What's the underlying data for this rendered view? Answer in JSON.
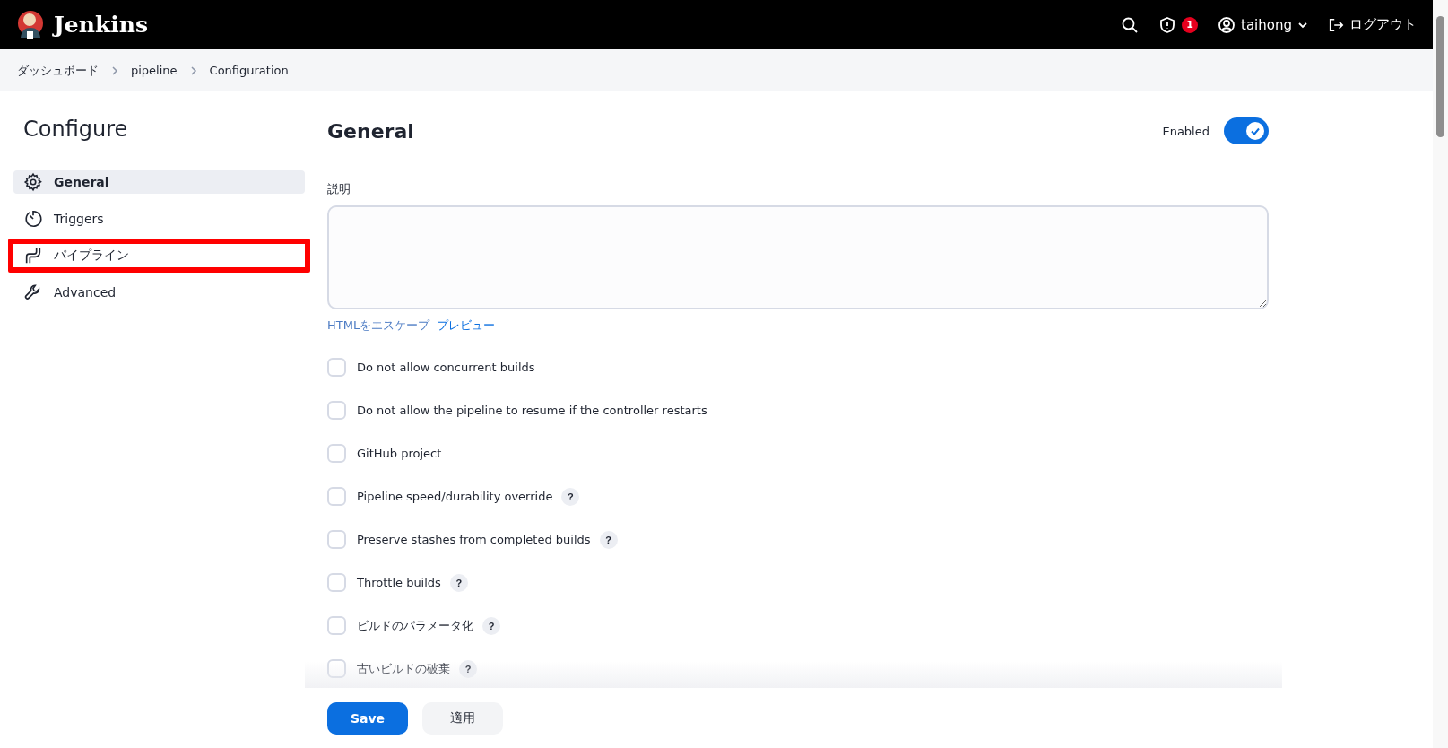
{
  "header": {
    "brand": "Jenkins",
    "security_count": "1",
    "user": "taihong",
    "logout": "ログアウト"
  },
  "breadcrumbs": [
    "ダッシュボード",
    "pipeline",
    "Configuration"
  ],
  "sidebar": {
    "title": "Configure",
    "items": [
      {
        "label": "General",
        "kind": "gear",
        "selected": true,
        "highlighted": false
      },
      {
        "label": "Triggers",
        "kind": "timer",
        "selected": false,
        "highlighted": false
      },
      {
        "label": "パイプライン",
        "kind": "pipe",
        "selected": false,
        "highlighted": true
      },
      {
        "label": "Advanced",
        "kind": "wrench",
        "selected": false,
        "highlighted": false
      }
    ]
  },
  "section": {
    "title": "General",
    "toggle_label": "Enabled",
    "enabled": true
  },
  "description": {
    "label": "説明",
    "escape_note": "HTMLをエスケープ",
    "preview_link": "プレビュー"
  },
  "options": [
    {
      "label": "Do not allow concurrent builds",
      "checked": false,
      "help": false
    },
    {
      "label": "Do not allow the pipeline to resume if the controller restarts",
      "checked": false,
      "help": false
    },
    {
      "label": "GitHub project",
      "checked": false,
      "help": false
    },
    {
      "label": "Pipeline speed/durability override",
      "checked": false,
      "help": true
    },
    {
      "label": "Preserve stashes from completed builds",
      "checked": false,
      "help": true
    },
    {
      "label": "Throttle builds",
      "checked": false,
      "help": true
    },
    {
      "label": "ビルドのパラメータ化",
      "checked": false,
      "help": true
    },
    {
      "label": "古いビルドの破棄",
      "checked": false,
      "help": true
    }
  ],
  "help_mark": "?",
  "buttons": [
    {
      "label": "Save",
      "kind": "primary"
    },
    {
      "label": "適用",
      "kind": "secondary"
    }
  ]
}
